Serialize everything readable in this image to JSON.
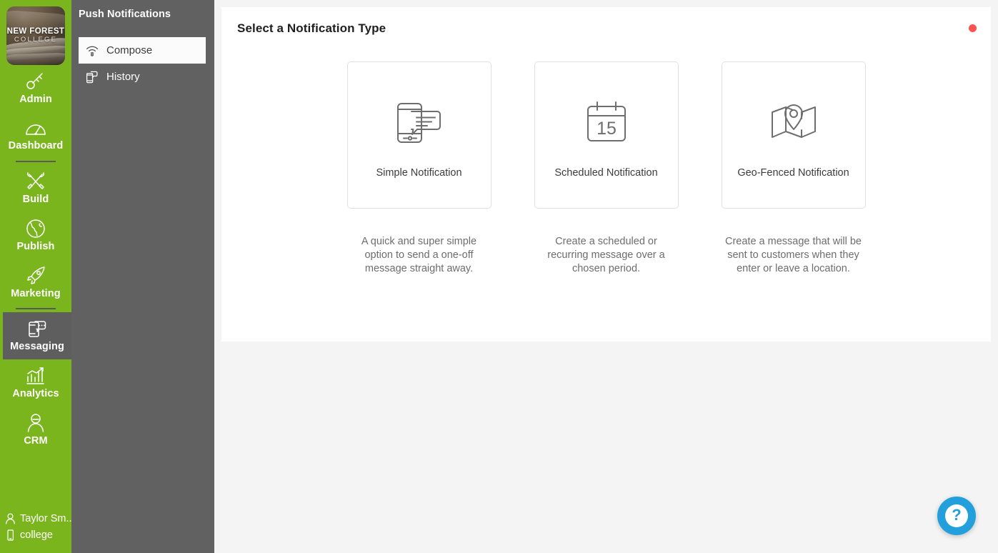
{
  "colors": {
    "brand_green": "#7ab51d",
    "panel_grey": "#616161",
    "active_grey": "#5e5e5e",
    "status_dot": "#fb5252",
    "help_blue": "#23a0dc",
    "page_bg": "#f4f4f4"
  },
  "brand": {
    "logo_line1": "NEW FOREST",
    "logo_line2": "COLLEGE"
  },
  "primary_nav": {
    "items": [
      {
        "label": "Admin",
        "icon": "key-icon",
        "active": false
      },
      {
        "label": "Dashboard",
        "icon": "gauge-icon",
        "active": false
      },
      {
        "label": "Build",
        "icon": "hammer-wrench-icon",
        "active": false
      },
      {
        "label": "Publish",
        "icon": "globe-icon",
        "active": false
      },
      {
        "label": "Marketing",
        "icon": "rocket-icon",
        "active": false
      },
      {
        "label": "Messaging",
        "icon": "phone-chat-icon",
        "active": true
      },
      {
        "label": "Analytics",
        "icon": "bar-chart-icon",
        "active": false
      },
      {
        "label": "CRM",
        "icon": "person-icon",
        "active": false
      }
    ],
    "footer": {
      "user_name": "Taylor Sm..",
      "user_icon": "person-icon",
      "app_name": "college",
      "app_icon": "mobile-icon"
    }
  },
  "secondary_nav": {
    "title": "Push Notifications",
    "items": [
      {
        "label": "Compose",
        "icon": "broadcast-icon",
        "active": true
      },
      {
        "label": "History",
        "icon": "phone-notification-icon",
        "active": false
      }
    ]
  },
  "main": {
    "card_title": "Select a Notification Type",
    "status_dot_icon": "red-status-dot",
    "notification_types": [
      {
        "label": "Simple Notification",
        "icon": "phone-message-icon",
        "description": "A quick and super simple option to send a one-off message straight away."
      },
      {
        "label": "Scheduled Notification",
        "icon": "calendar-15-icon",
        "description": "Create a scheduled or recurring message over a chosen period."
      },
      {
        "label": "Geo-Fenced Notification",
        "icon": "map-pin-icon",
        "description": "Create a message that will be sent to customers when they enter or leave a location."
      }
    ]
  },
  "help": {
    "label": "?",
    "icon": "question-mark-icon"
  }
}
